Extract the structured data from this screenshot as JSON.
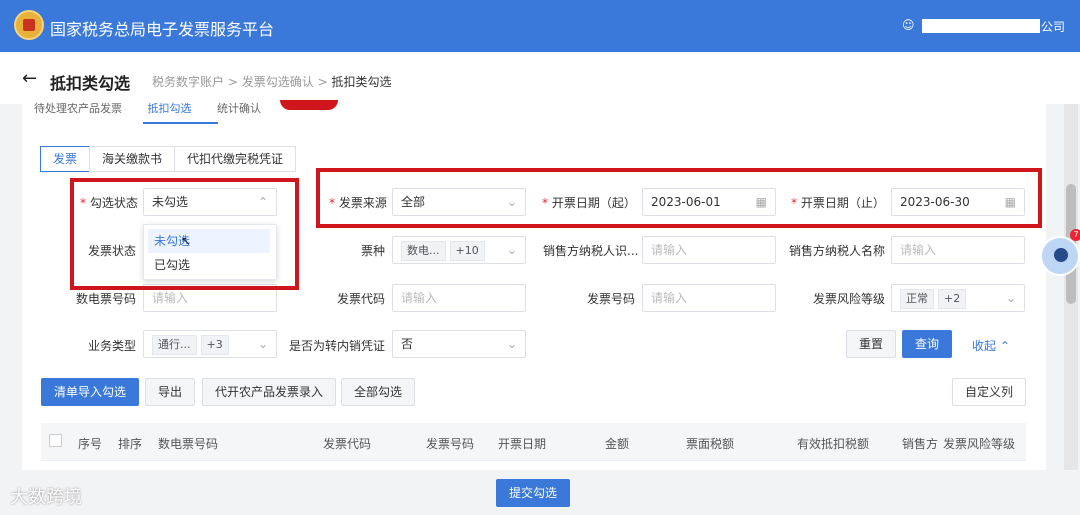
{
  "header": {
    "title": "国家税务总局电子发票服务平台",
    "company_suffix": "公司"
  },
  "page": {
    "back": "←",
    "title": "抵扣类勾选",
    "breadcrumb": [
      "税务数字账户",
      ">",
      "发票勾选确认",
      ">",
      "抵扣类勾选"
    ]
  },
  "top_tabs": [
    "待处理农产品发票",
    "抵扣勾选",
    "统计确认"
  ],
  "sub_tabs": [
    "发票",
    "海关缴款书",
    "代扣代缴完税凭证"
  ],
  "filters": {
    "check_status": {
      "label": "勾选状态",
      "value": "未勾选",
      "options": [
        "未勾选",
        "已勾选"
      ]
    },
    "source": {
      "label": "发票来源",
      "value": "全部"
    },
    "date_start": {
      "label": "开票日期（起）",
      "value": "2023-06-01"
    },
    "date_end": {
      "label": "开票日期（止）",
      "value": "2023-06-30"
    },
    "invoice_status": {
      "label": "发票状态"
    },
    "ticket_type": {
      "label": "票种",
      "tag1": "数电...",
      "tag2": "+10"
    },
    "seller_id": {
      "label": "销售方纳税人识...",
      "placeholder": "请输入"
    },
    "seller_name": {
      "label": "销售方纳税人名称",
      "placeholder": "请输入"
    },
    "digital_no": {
      "label": "数电票号码",
      "placeholder": "请输入"
    },
    "invoice_code": {
      "label": "发票代码",
      "placeholder": "请输入"
    },
    "invoice_no": {
      "label": "发票号码",
      "placeholder": "请输入"
    },
    "risk_level": {
      "label": "发票风险等级",
      "tag1": "正常",
      "tag2": "+2"
    },
    "biz_type": {
      "label": "业务类型",
      "tag1": "通行...",
      "tag2": "+3"
    },
    "transfer": {
      "label": "是否为转内销凭证",
      "value": "否"
    }
  },
  "actions": {
    "reset": "重置",
    "query": "查询",
    "collapse": "收起"
  },
  "toolbar": {
    "import": "清单导入勾选",
    "export": "导出",
    "agri": "代开农产品发票录入",
    "select_all": "全部勾选",
    "custom": "自定义列"
  },
  "table": {
    "columns": [
      "序号",
      "排序",
      "数电票号码",
      "发票代码",
      "发票号码",
      "开票日期",
      "金额",
      "票面税额",
      "有效抵扣税额",
      "销售方",
      "发票风险等级"
    ]
  },
  "submit": "提交勾选",
  "watermark": "大数跨境",
  "badge_count": "7",
  "colors": {
    "primary": "#3a78d9",
    "highlight": "#d0161d"
  }
}
